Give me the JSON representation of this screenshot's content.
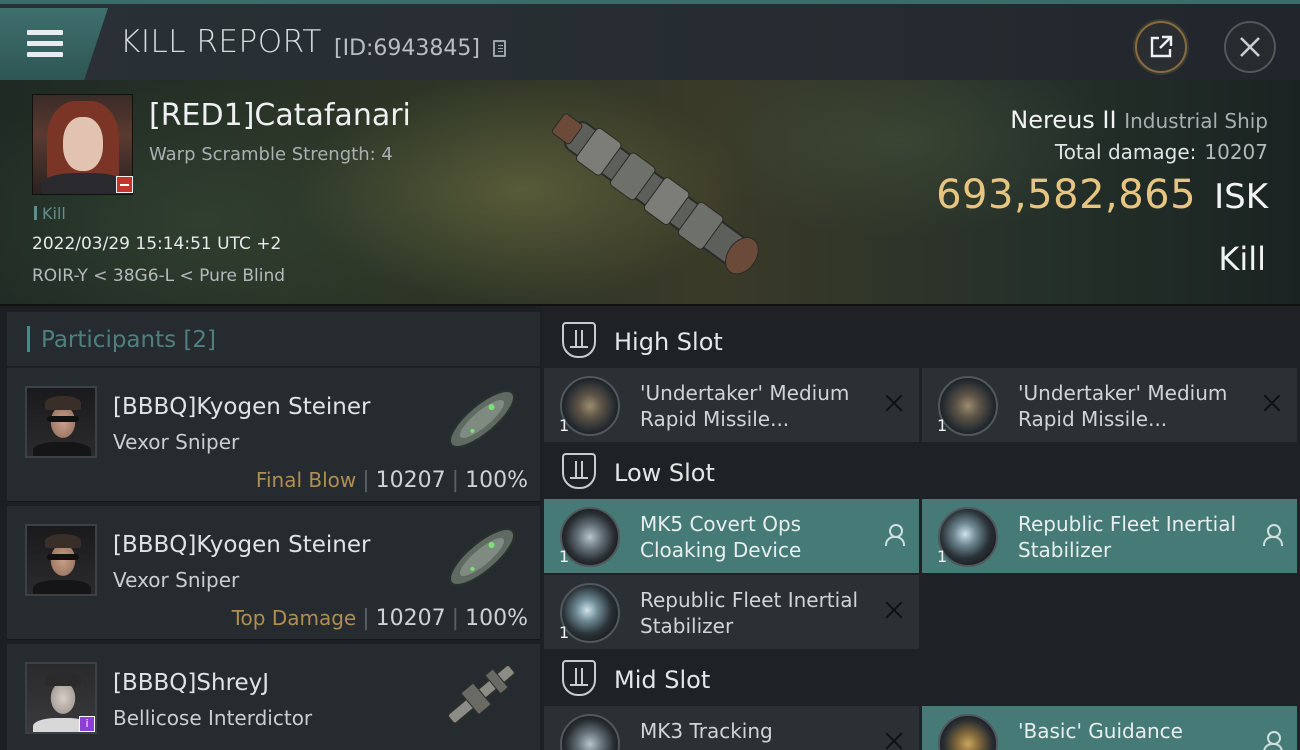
{
  "header": {
    "title": "KILL REPORT",
    "report_id": "[ID:6943845]",
    "icons": {
      "menu": "hamburger-menu-icon",
      "copy": "copy-icon",
      "share": "share-external-icon",
      "close": "close-icon"
    }
  },
  "victim": {
    "name": "[RED1]Catafanari",
    "warp_scramble": "Warp Scramble Strength: 4",
    "tag": "Kill",
    "datetime": "2022/03/29 15:14:51 UTC +2",
    "location": "ROIR-Y < 38G6-L < Pure Blind",
    "ship_name": "Nereus II",
    "ship_class": "Industrial Ship",
    "total_damage_label": "Total damage:",
    "total_damage_value": "10207",
    "isk_value": "693,582,865",
    "isk_unit": "ISK",
    "result": "Kill"
  },
  "participants": {
    "title": "Participants",
    "count": "[2]",
    "items": [
      {
        "name": "[BBBQ]Kyogen Steiner",
        "ship": "Vexor Sniper",
        "tag": "Final Blow",
        "damage": "10207",
        "percent": "100%"
      },
      {
        "name": "[BBBQ]Kyogen Steiner",
        "ship": "Vexor Sniper",
        "tag": "Top Damage",
        "damage": "10207",
        "percent": "100%"
      },
      {
        "name": "[BBBQ]ShreyJ",
        "ship": "Bellicose Interdictor"
      }
    ]
  },
  "fittings": {
    "high_slot": {
      "title": "High Slot",
      "modules": [
        {
          "name": "'Undertaker' Medium Rapid Missile...",
          "qty": "1",
          "status": "destroyed"
        },
        {
          "name": "'Undertaker' Medium Rapid Missile...",
          "qty": "1",
          "status": "destroyed"
        }
      ]
    },
    "low_slot": {
      "title": "Low Slot",
      "modules": [
        {
          "name": "MK5 Covert Ops Cloaking Device",
          "qty": "1",
          "status": "dropped"
        },
        {
          "name": "Republic Fleet Inertial Stabilizer",
          "qty": "1",
          "status": "dropped"
        },
        {
          "name": "Republic Fleet Inertial Stabilizer",
          "qty": "1",
          "status": "destroyed"
        }
      ]
    },
    "mid_slot": {
      "title": "Mid Slot",
      "modules": [
        {
          "name": "MK3 Tracking",
          "status": "destroyed"
        },
        {
          "name": "'Basic' Guidance",
          "status": "dropped"
        }
      ]
    }
  },
  "colors": {
    "accent_teal": "#3c6c6a",
    "isk_gold": "#e7c581",
    "dropped_bg": "#457a77",
    "destroyed_bg": "#2b3035",
    "tag_gold": "#b08e52"
  }
}
